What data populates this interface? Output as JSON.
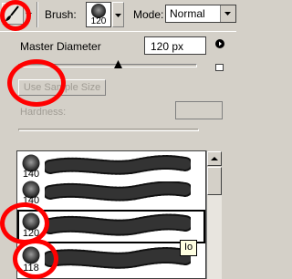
{
  "toolbar": {
    "brush_label": "Brush:",
    "brush_size": "120",
    "mode_label": "Mode:",
    "mode_value": "Normal"
  },
  "panel": {
    "master_diameter_label": "Master Diameter",
    "master_diameter_value": "120 px",
    "use_sample_size_label": "Use Sample Size",
    "hardness_label": "Hardness:"
  },
  "brush_list": [
    {
      "size": "140"
    },
    {
      "size": "140"
    },
    {
      "size": "120"
    },
    {
      "size": "118"
    }
  ],
  "tooltip": "Io",
  "colors": {
    "ui_face": "#d4d0c8",
    "annotation_red": "#ff0000"
  }
}
